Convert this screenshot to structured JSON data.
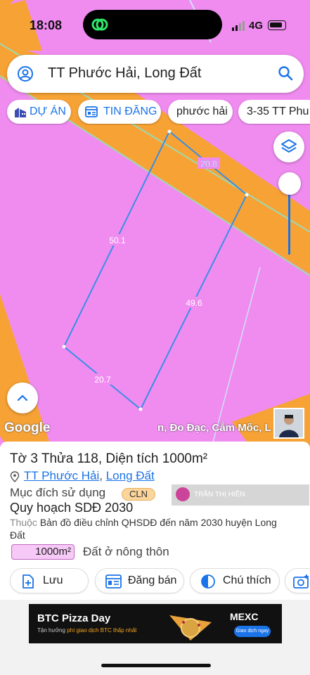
{
  "status": {
    "time": "18:08",
    "network": "4G"
  },
  "search": {
    "text": "TT Phước Hải, Long Đất"
  },
  "chips": [
    {
      "label": "DỰ ÁN"
    },
    {
      "label": "TIN ĐĂNG"
    },
    {
      "label": "phước hải"
    },
    {
      "label": "3-35 TT Phu"
    }
  ],
  "map": {
    "edge_labels": [
      "20.8",
      "50.1",
      "49.6",
      "20.7"
    ],
    "google": "Google",
    "banner": "n, Đo Đạc, Cắm Mốc, L",
    "colors": {
      "land": "#f08cf0",
      "road": "#f7a235",
      "parcel": "#3a8ee6"
    }
  },
  "sheet": {
    "title": "Tờ 3 Thửa 118, Diện tích 1000m²",
    "loc_a": "TT Phước Hải",
    "loc_sep": ", ",
    "loc_b": "Long Đất",
    "purpose_label": "Mục đích sử dụng",
    "purpose_code": "CLN",
    "plan": "Quy hoạch SDĐ 2030",
    "owner": "TRẦN THỊ HIỀN",
    "note_prefix": "Thuộc ",
    "note_body": "Bản đồ điều chỉnh QHSDĐ đến năm 2030 huyện Long Đất",
    "area_value": "1000m²",
    "area_type": "Đất ở nông thôn",
    "actions": [
      "Lưu",
      "Đăng bán",
      "Chú thích"
    ]
  },
  "ad": {
    "title": "BTC Pizza Day",
    "line_a": "Tận hưởng ",
    "line_b": "phí giao dịch BTC thấp nhất",
    "brand": "MEXC",
    "cta": "Giao dịch ngay"
  }
}
